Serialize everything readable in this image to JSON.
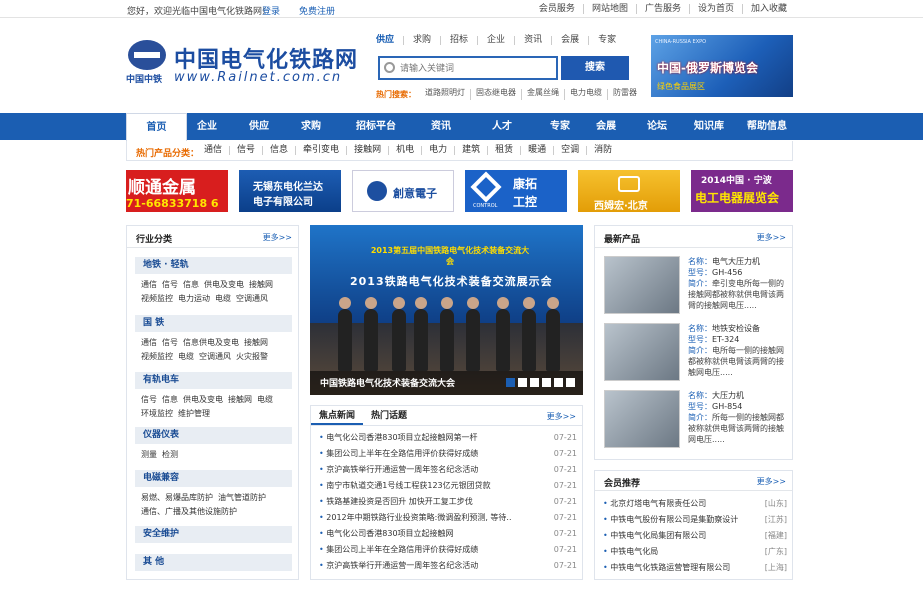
{
  "topbar": {
    "welcome": "您好，欢迎光临中国电气化铁路网!",
    "login": "登录",
    "register": "免费注册",
    "links": [
      "会员服务",
      "网站地图",
      "广告服务",
      "设为首页",
      "加入收藏"
    ]
  },
  "logo": {
    "name": "中国电气化铁路网",
    "sub": "中国中铁",
    "url": "www.Railnet.com.cn"
  },
  "search": {
    "tabs": [
      "供应",
      "求购",
      "招标",
      "企业",
      "资讯",
      "会展",
      "专家"
    ],
    "placeholder": "请输入关键词",
    "button": "搜索",
    "hot_label": "热门搜索：",
    "hot_items": [
      "道路照明灯",
      "固态继电器",
      "金属丝绳",
      "电力电缆",
      "防雷器"
    ]
  },
  "expo_ad": {
    "small": "CHINA-RUSSIA EXPO",
    "title": "中国-俄罗斯博览会",
    "sub": "绿色食品展区"
  },
  "nav": {
    "items": [
      "首页",
      "企业",
      "供应",
      "求购",
      "招标平台",
      "资讯",
      "人才",
      "专家",
      "会展",
      "论坛",
      "知识库",
      "帮助信息"
    ]
  },
  "hot_category": {
    "label": "热门产品分类：",
    "items": [
      "通信",
      "信号",
      "信息",
      "牵引变电",
      "接触网",
      "机电",
      "电力",
      "建筑",
      "租赁",
      "暖通",
      "空调",
      "消防"
    ]
  },
  "ads": {
    "ad1": {
      "line1": "顺通金属",
      "line2": "71-66833718 6"
    },
    "ad2": {
      "line1": "无锡东电化兰达",
      "line2": "电子有限公司"
    },
    "ad3": {
      "line1": "創意電子"
    },
    "ad4": {
      "line1": "康拓",
      "line2": "工控",
      "line3": "CONTROL"
    },
    "ad5": {
      "line1": "西姆宏·北京"
    },
    "ad6": {
      "line1": "2014中国 · 宁波",
      "line2": "电工电器展览会"
    }
  },
  "industry": {
    "title": "行业分类",
    "more": "更多>>",
    "categories": [
      {
        "name": "地铁 · 轻轨",
        "items": [
          "通信",
          "信号",
          "信息",
          "供电及变电",
          "接触网",
          "视频监控",
          "电力运动",
          "电缆",
          "空调通风"
        ]
      },
      {
        "name": "国 铁",
        "items": [
          "通信",
          "信号",
          "信息供电及变电",
          "接触网",
          "视频监控",
          "电缆",
          "空调通风",
          "火灾报警"
        ]
      },
      {
        "name": "有轨电车",
        "items": [
          "信号",
          "信息",
          "供电及变电",
          "接触网",
          "电缆",
          "环境监控",
          "维护管理"
        ]
      },
      {
        "name": "仪器仪表",
        "items": [
          "测量",
          "检测"
        ]
      },
      {
        "name": "电磁兼容",
        "items": [
          "易燃、易爆品库防护",
          "油气管道防护",
          "通信、广播及其他设施防护"
        ]
      },
      {
        "name": "安全维护",
        "items": []
      },
      {
        "name": "其 他",
        "items": []
      }
    ]
  },
  "slide": {
    "stage_line1": "2013第五届中国铁路电气化技术装备交流大会",
    "stage_line2": "2013铁路电气化技术装备交流展示会",
    "caption": "中国铁路电气化技术装备交流大会",
    "dots": 6,
    "active_dot": 1
  },
  "news": {
    "tabs": [
      "焦点新闻",
      "热门话题"
    ],
    "more": "更多>>",
    "items": [
      {
        "title": "电气化公司香港830项目立起接触网第一杆",
        "date": "07-21"
      },
      {
        "title": "集团公司上半年在全路信用评价获得好成绩",
        "date": "07-21"
      },
      {
        "title": "京沪高铁举行开通运营一周年签名纪念活动",
        "date": "07-21"
      },
      {
        "title": "南宁市轨道交通1号线工程获123亿元银团贷款",
        "date": "07-21"
      },
      {
        "title": "铁路基建投资是否回升 加快开工复工步伐",
        "date": "07-21"
      },
      {
        "title": "2012年中期铁路行业投资策略:微调盈利预测, 等待..",
        "date": "07-21"
      },
      {
        "title": "电气化公司香港830项目立起接触网",
        "date": "07-21"
      },
      {
        "title": "集团公司上半年在全路信用评价获得好成绩",
        "date": "07-21"
      },
      {
        "title": "京沪高铁举行开通运营一周年签名纪念活动",
        "date": "07-21"
      }
    ]
  },
  "products": {
    "title": "最新产品",
    "more": "更多>>",
    "name_label": "名称：",
    "model_label": "型号：",
    "desc_label": "简介：",
    "items": [
      {
        "name": "电气大压力机",
        "model": "GH-456",
        "desc": "牵引变电所每一侧的接触网都被称就供电臂该两臂的接触网电压....."
      },
      {
        "name": "地铁安检设备",
        "model": "ET-324",
        "desc": "电所每一侧的接触网都被称就供电臂该两臂的接触网电压....."
      },
      {
        "name": "大压力机",
        "model": "GH-854",
        "desc": "所每一侧的接触网都被称就供电臂该两臂的接触网电压....."
      }
    ]
  },
  "members": {
    "title": "会员推荐",
    "more": "更多>>",
    "items": [
      {
        "name": "北京灯塔电气有限责任公司",
        "region": "[山东]"
      },
      {
        "name": "中铁电气股份有限公司是集勤察设计",
        "region": "[江苏]"
      },
      {
        "name": "中铁电气化局集团有限公司",
        "region": "[福建]"
      },
      {
        "name": "中铁电气化局",
        "region": "[广东]"
      },
      {
        "name": "中铁电气化铁路运营管理有限公司",
        "region": "[上海]"
      }
    ]
  },
  "colors": {
    "brand": "#1b5eb2",
    "accent": "#e86a00"
  }
}
